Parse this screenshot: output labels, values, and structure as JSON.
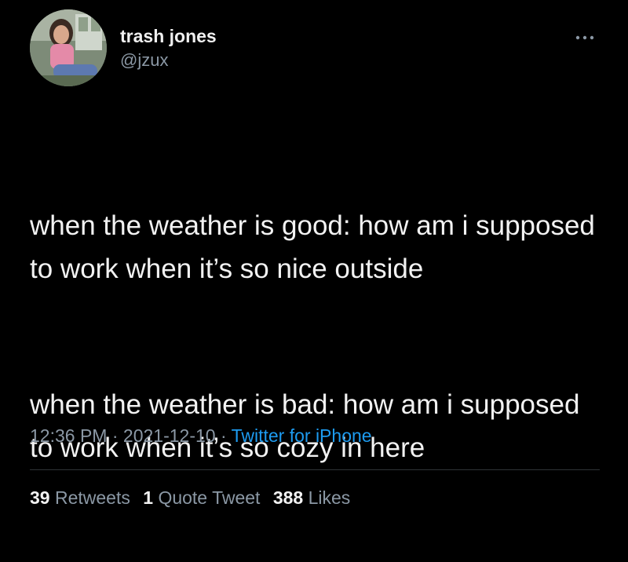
{
  "tweet": {
    "author": {
      "display_name": "trash jones",
      "handle": "@jzux",
      "avatar_icon": "profile-photo"
    },
    "more_icon": "more-horizontal-icon",
    "paragraphs": [
      "when the weather is good: how am i supposed to work when it’s so nice outside",
      "when the weather is bad: how am i supposed to work when it’s so cozy in here"
    ],
    "meta": {
      "time": "12:36 PM",
      "separator": " · ",
      "date": "2021-12-10",
      "source": "Twitter for iPhone"
    },
    "stats": {
      "retweets_count": "39",
      "retweets_label": "Retweets",
      "quotes_count": "1",
      "quotes_label": "Quote Tweet",
      "likes_count": "388",
      "likes_label": "Likes"
    }
  },
  "colors": {
    "background": "#000000",
    "text": "#f2f2f2",
    "secondary": "#8b98a5",
    "link": "#1d9bf0",
    "divider": "#2f3336"
  }
}
